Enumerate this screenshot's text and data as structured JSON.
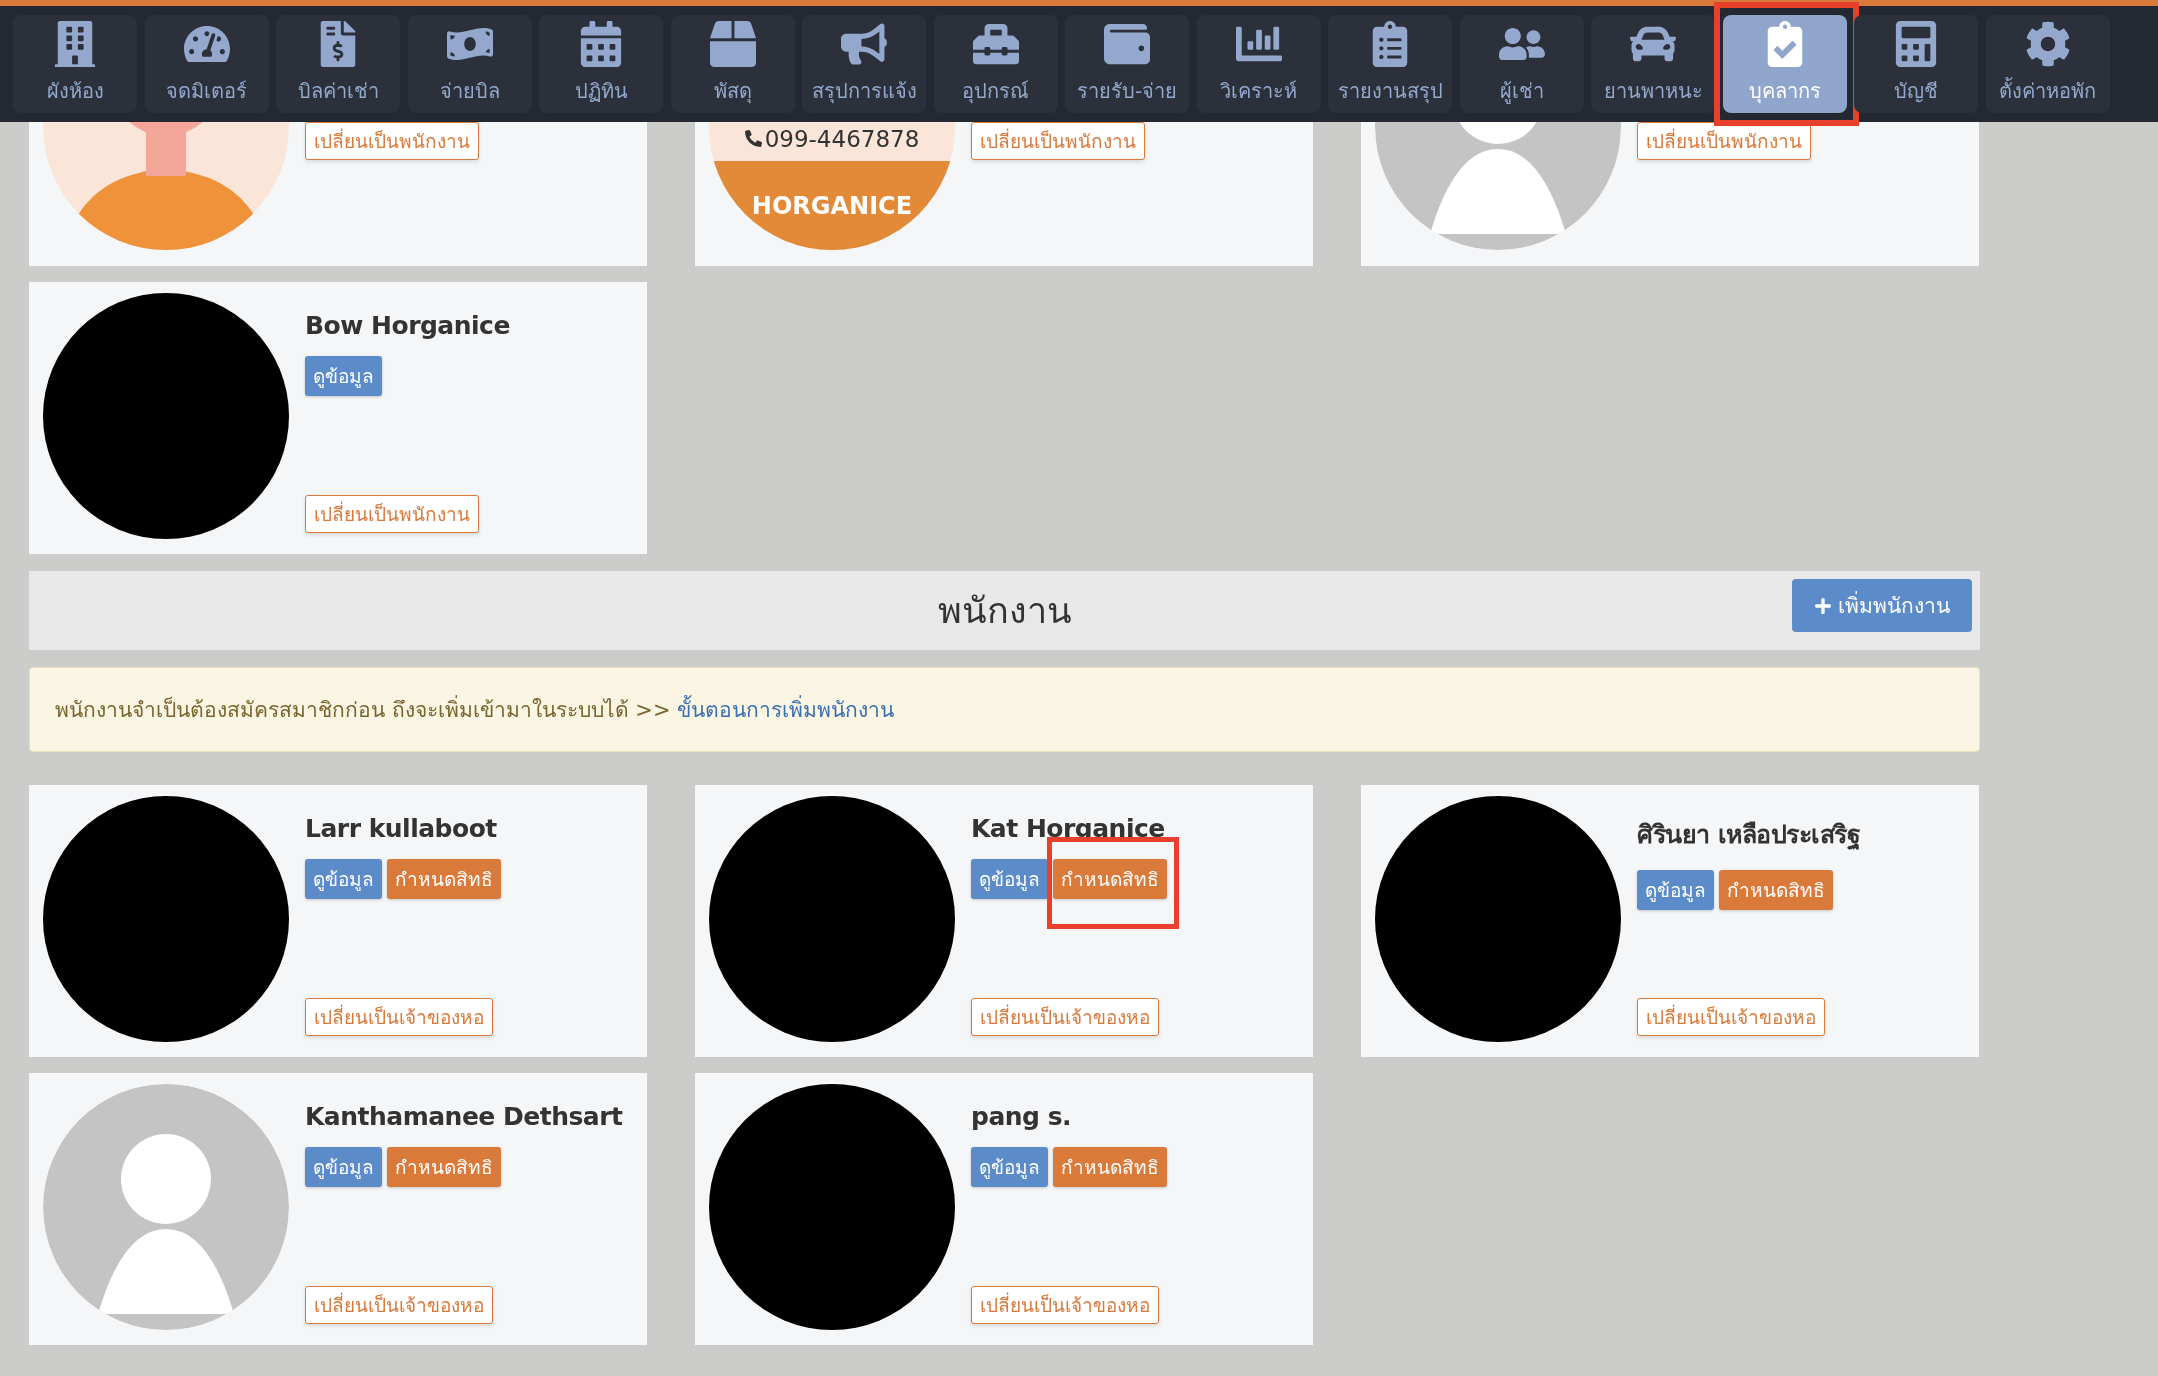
{
  "nav": [
    {
      "label": "ผังห้อง",
      "selected": false,
      "annotated": false
    },
    {
      "label": "จดมิเตอร์",
      "selected": false,
      "annotated": false
    },
    {
      "label": "บิลค่าเช่า",
      "selected": false,
      "annotated": false
    },
    {
      "label": "จ่ายบิล",
      "selected": false,
      "annotated": false
    },
    {
      "label": "ปฏิทิน",
      "selected": false,
      "annotated": false
    },
    {
      "label": "พัสดุ",
      "selected": false,
      "annotated": false
    },
    {
      "label": "สรุปการแจ้ง",
      "selected": false,
      "annotated": false
    },
    {
      "label": "อุปกรณ์",
      "selected": false,
      "annotated": false
    },
    {
      "label": "รายรับ-จ่าย",
      "selected": false,
      "annotated": false
    },
    {
      "label": "วิเคราะห์",
      "selected": false,
      "annotated": false
    },
    {
      "label": "รายงานสรุป",
      "selected": false,
      "annotated": false
    },
    {
      "label": "ผู้เช่า",
      "selected": false,
      "annotated": false
    },
    {
      "label": "ยานพาหนะ",
      "selected": false,
      "annotated": false
    },
    {
      "label": "บุคลากร",
      "selected": true,
      "annotated": true
    },
    {
      "label": "บัญชี",
      "selected": false,
      "annotated": false
    },
    {
      "label": "ตั้งค่าหอพัก",
      "selected": false,
      "annotated": false
    }
  ],
  "owners_partial": [
    {
      "avatar": {
        "kind": "illustration"
      },
      "switch_button": "เปลี่ยนเป็นพนักงาน"
    },
    {
      "avatar": {
        "kind": "logo",
        "phone": "099-4467878",
        "brand": "HORGANICE"
      },
      "switch_button": "เปลี่ยนเป็นพนักงาน"
    },
    {
      "avatar": {
        "kind": "silhouette"
      },
      "switch_button": "เปลี่ยนเป็นพนักงาน"
    }
  ],
  "owners": [
    {
      "name": "Bow Horganice",
      "avatar": {
        "kind": "hidden"
      },
      "view_button": "ดูข้อมูล",
      "switch_button": "เปลี่ยนเป็นพนักงาน"
    }
  ],
  "staff_section": {
    "title": "พนักงาน",
    "add_button": "เพิ่มพนักงาน",
    "notice": "พนักงานจำเป็นต้องสมัครสมาชิกก่อน ถึงจะเพิ่มเข้ามาในระบบได้ >>",
    "notice_link": "ขั้นตอนการเพิ่มพนักงาน"
  },
  "staff": [
    {
      "name": "Larr kullaboot",
      "avatar": {
        "kind": "hidden"
      },
      "view_button": "ดูข้อมูล",
      "permission_button": "กำหนดสิทธิ",
      "switch_button": "เปลี่ยนเป็นเจ้าของหอ",
      "annotated": false
    },
    {
      "name": "Kat Horganice",
      "avatar": {
        "kind": "hidden"
      },
      "view_button": "ดูข้อมูล",
      "permission_button": "กำหนดสิทธิ",
      "switch_button": "เปลี่ยนเป็นเจ้าของหอ",
      "annotated": true
    },
    {
      "name": "ศิรินยา เหลือประเสริฐ",
      "avatar": {
        "kind": "hidden"
      },
      "view_button": "ดูข้อมูล",
      "permission_button": "กำหนดสิทธิ",
      "switch_button": "เปลี่ยนเป็นเจ้าของหอ",
      "annotated": false
    },
    {
      "name": "Kanthamanee Dethsart",
      "avatar": {
        "kind": "silhouette"
      },
      "view_button": "ดูข้อมูล",
      "permission_button": "กำหนดสิทธิ",
      "switch_button": "เปลี่ยนเป็นเจ้าของหอ",
      "annotated": false
    },
    {
      "name": "pang s.",
      "avatar": {
        "kind": "hidden"
      },
      "view_button": "ดูข้อมูล",
      "permission_button": "กำหนดสิทธิ",
      "switch_button": "เปลี่ยนเป็นเจ้าของหอ",
      "annotated": false
    }
  ]
}
